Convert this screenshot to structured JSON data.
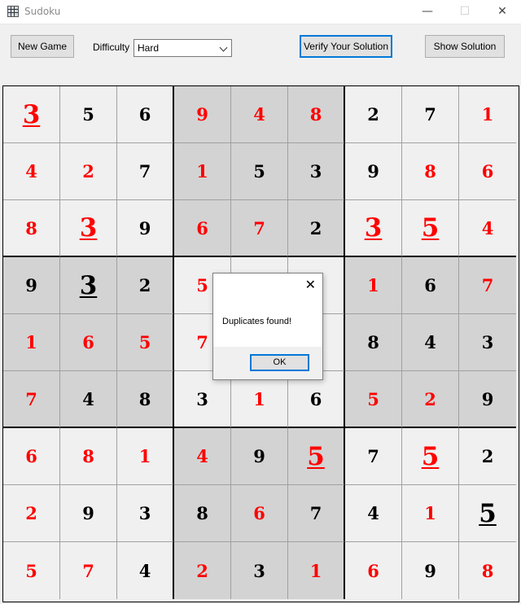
{
  "window": {
    "title": "Sudoku",
    "minimize_glyph": "—",
    "maximize_glyph": "☐",
    "close_glyph": "✕"
  },
  "toolbar": {
    "new_game_label": "New Game",
    "difficulty_label": "Difficulty",
    "difficulty_value": "Hard",
    "verify_label": "Verify Your Solution",
    "show_solution_label": "Show Solution"
  },
  "board": {
    "rows": [
      [
        3,
        5,
        6,
        9,
        4,
        8,
        2,
        7,
        1
      ],
      [
        4,
        2,
        7,
        1,
        5,
        3,
        9,
        8,
        6
      ],
      [
        8,
        3,
        9,
        6,
        7,
        2,
        3,
        5,
        4
      ],
      [
        9,
        3,
        2,
        5,
        null,
        null,
        1,
        6,
        7
      ],
      [
        1,
        6,
        5,
        7,
        null,
        null,
        8,
        4,
        3
      ],
      [
        7,
        4,
        8,
        3,
        1,
        6,
        5,
        2,
        9
      ],
      [
        6,
        8,
        1,
        4,
        9,
        5,
        7,
        5,
        2
      ],
      [
        2,
        9,
        3,
        8,
        6,
        7,
        4,
        1,
        5
      ],
      [
        5,
        7,
        4,
        2,
        3,
        1,
        6,
        9,
        8
      ]
    ],
    "red": [
      [
        1,
        0,
        0,
        1,
        1,
        1,
        0,
        0,
        1
      ],
      [
        1,
        1,
        0,
        1,
        0,
        0,
        0,
        1,
        1
      ],
      [
        1,
        1,
        0,
        1,
        1,
        0,
        1,
        1,
        1
      ],
      [
        0,
        0,
        0,
        1,
        0,
        0,
        1,
        0,
        1
      ],
      [
        1,
        1,
        1,
        1,
        0,
        0,
        0,
        0,
        0
      ],
      [
        1,
        0,
        0,
        0,
        1,
        0,
        1,
        1,
        0
      ],
      [
        1,
        1,
        1,
        1,
        0,
        1,
        0,
        1,
        0
      ],
      [
        1,
        0,
        0,
        0,
        1,
        0,
        0,
        1,
        0
      ],
      [
        1,
        1,
        0,
        1,
        0,
        1,
        1,
        0,
        1
      ]
    ],
    "highlighted": [
      [
        0,
        0
      ],
      [
        2,
        1
      ],
      [
        2,
        6
      ],
      [
        2,
        7
      ],
      [
        3,
        1
      ],
      [
        6,
        5
      ],
      [
        6,
        7
      ],
      [
        7,
        8
      ]
    ]
  },
  "dialog": {
    "message": "Duplicates found!",
    "ok_label": "OK",
    "close_glyph": "✕"
  }
}
